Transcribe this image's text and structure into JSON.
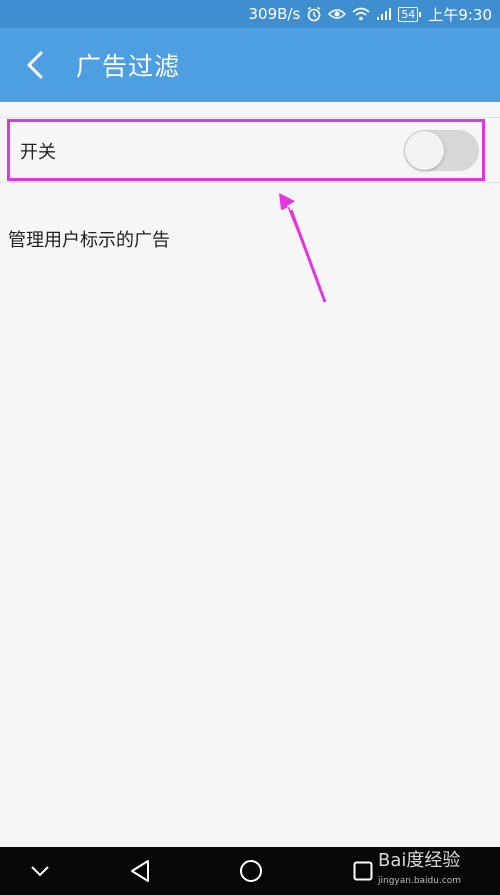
{
  "status_bar": {
    "speed": "309B/s",
    "battery": "54",
    "time": "上午9:30",
    "icons": [
      "alarm-icon",
      "eye-icon",
      "wifi-icon",
      "signal-icon",
      "battery-icon"
    ]
  },
  "app_bar": {
    "back_icon": "chevron-left-icon",
    "title": "广告过滤"
  },
  "settings": {
    "switch_label": "开关",
    "switch_on": false,
    "description": "管理用户标示的广告"
  },
  "annotation": {
    "highlight_color": "#e335e0"
  },
  "nav_bar": {
    "icons": [
      "chevron-down-icon",
      "back-triangle-icon",
      "home-circle-icon",
      "recents-square-icon"
    ],
    "watermark": "Bai度经验",
    "watermark_url": "jingyan.baidu.com"
  },
  "colors": {
    "status_bar": "#3f8fd0",
    "app_bar": "#4e9fe2",
    "background": "#f6f6f6",
    "toggle_off": "#d7d7d7"
  }
}
